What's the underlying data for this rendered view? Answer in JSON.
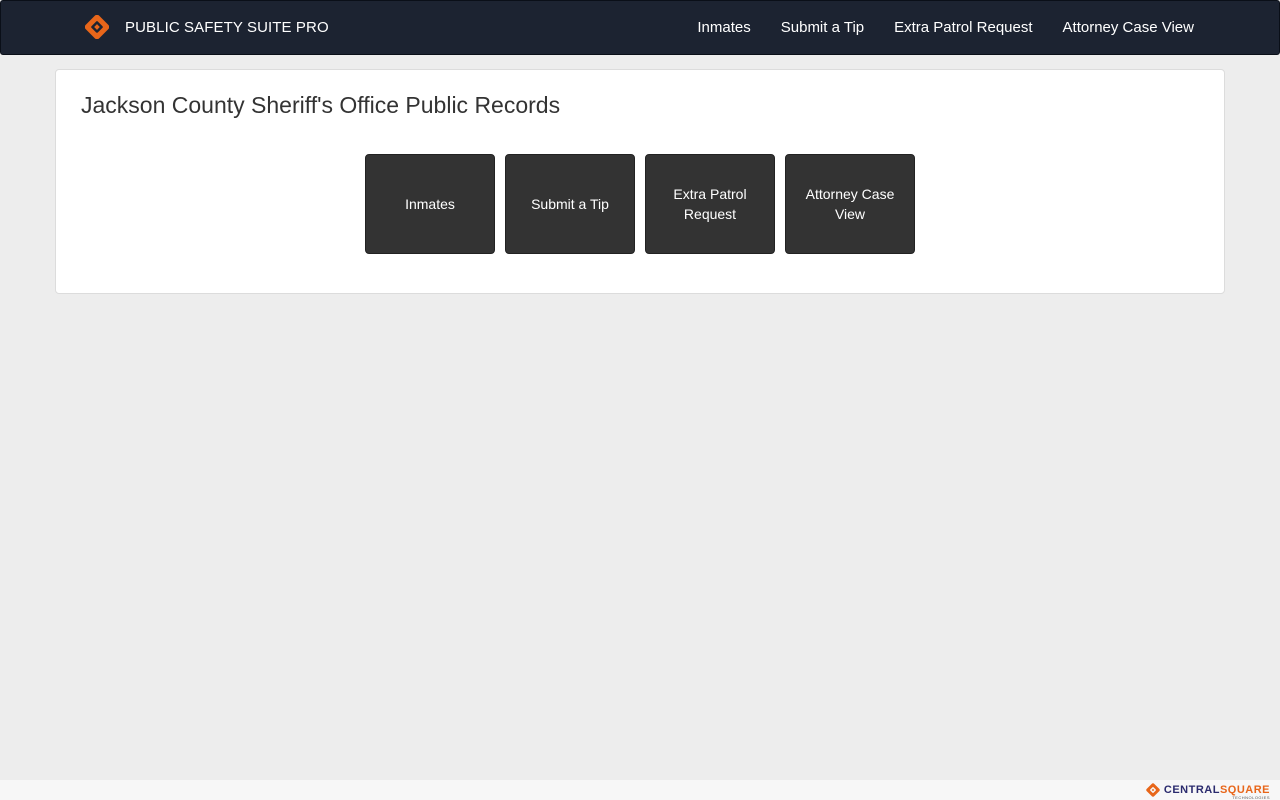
{
  "navbar": {
    "brand_title": "PUBLIC SAFETY SUITE PRO",
    "brand_icon": "centralsquare-logo-icon",
    "links": [
      "Inmates",
      "Submit a Tip",
      "Extra Patrol Request",
      "Attorney Case View"
    ]
  },
  "main": {
    "title": "Jackson County Sheriff's Office Public Records",
    "tiles": [
      "Inmates",
      "Submit a Tip",
      "Extra Patrol Request",
      "Attorney Case View"
    ]
  },
  "footer": {
    "logo_part1": "CENTRAL",
    "logo_part2": "SQUARE",
    "logo_sub": "TECHNOLOGIES"
  },
  "colors": {
    "navbar_bg": "#1c2331",
    "tile_bg": "#333333",
    "accent": "#e8661a",
    "page_bg": "#ededed"
  }
}
